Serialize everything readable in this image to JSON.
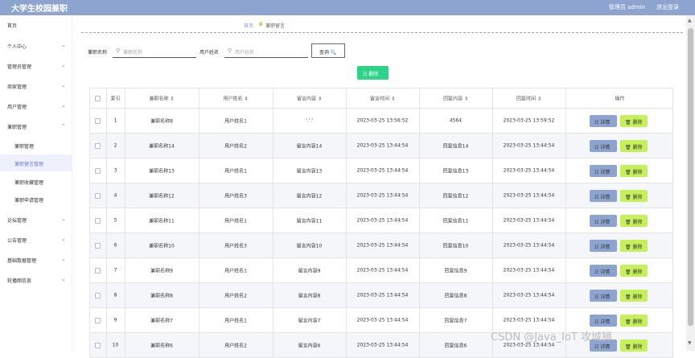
{
  "header": {
    "title": "大学生校园兼职",
    "user": "管理员 admin",
    "logout": "退出登录"
  },
  "sidebar": {
    "items": [
      {
        "label": "首页",
        "chev": ""
      },
      {
        "label": "个人中心",
        "chev": "⌄"
      },
      {
        "label": "管理员管理",
        "chev": "⌄"
      },
      {
        "label": "商家管理",
        "chev": "⌄"
      },
      {
        "label": "用户管理",
        "chev": "⌄"
      },
      {
        "label": "兼职管理",
        "chev": "⌄"
      }
    ],
    "subitems": [
      {
        "label": "兼职管理"
      },
      {
        "label": "兼职留言管理"
      },
      {
        "label": "兼职收藏管理"
      },
      {
        "label": "兼职申请管理"
      }
    ],
    "items2": [
      {
        "label": "论坛管理",
        "chev": "⌄"
      },
      {
        "label": "公告管理",
        "chev": "⌄"
      },
      {
        "label": "基础数据管理",
        "chev": "⌄"
      },
      {
        "label": "轮播图信息",
        "chev": "⌄"
      }
    ]
  },
  "breadcrumb": {
    "home": "首页",
    "sep": "♛",
    "current": "兼职留言"
  },
  "search": {
    "job_label": "兼职名称",
    "job_placeholder": "兼职名称",
    "user_label": "用户姓名",
    "user_placeholder": "用户姓名",
    "query_label": "查询 🔍"
  },
  "actions": {
    "delete_label": "☷ 删除"
  },
  "table": {
    "headers": [
      "索引",
      "兼职名称 ⇕",
      "用户姓名 ⇕",
      "留言内容 ⇕",
      "留言时间 ⇕",
      "回复内容 ⇕",
      "回复时间 ⇕",
      "操作"
    ],
    "detail_label": "☷ 详情",
    "delete_label": "🗑 删除",
    "rows": [
      [
        "1",
        "兼职名称8",
        "用户姓名1",
        "'.'.'",
        "2023-03-25 13:56:52",
        "4564",
        "2023-03-25 13:59:52"
      ],
      [
        "2",
        "兼职名称14",
        "用户姓名2",
        "留言内容14",
        "2023-03-25 13:44:54",
        "回复信息14",
        "2023-03-25 13:44:54"
      ],
      [
        "3",
        "兼职名称13",
        "用户姓名1",
        "留言内容13",
        "2023-03-25 13:44:54",
        "回复信息13",
        "2023-03-25 13:44:54"
      ],
      [
        "4",
        "兼职名称12",
        "用户姓名3",
        "留言内容12",
        "2023-03-25 13:44:54",
        "回复信息12",
        "2023-03-25 13:44:54"
      ],
      [
        "5",
        "兼职名称11",
        "用户姓名1",
        "留言内容11",
        "2023-03-25 13:44:54",
        "回复信息11",
        "2023-03-25 13:44:54"
      ],
      [
        "6",
        "兼职名称10",
        "用户姓名3",
        "留言内容10",
        "2023-03-25 13:44:54",
        "回复信息10",
        "2023-03-25 13:44:54"
      ],
      [
        "7",
        "兼职名称9",
        "用户姓名1",
        "留言内容9",
        "2023-03-25 13:44:54",
        "回复信息9",
        "2023-03-25 13:44:54"
      ],
      [
        "8",
        "兼职名称8",
        "用户姓名2",
        "留言内容8",
        "2023-03-25 13:44:54",
        "回复信息8",
        "2023-03-25 13:44:54"
      ],
      [
        "9",
        "兼职名称7",
        "用户姓名1",
        "留言内容7",
        "2023-03-25 13:44:54",
        "回复信息7",
        "2023-03-25 13:44:54"
      ],
      [
        "10",
        "兼职名称6",
        "用户姓名2",
        "留言内容6",
        "2023-03-25 13:44:54",
        "回复信息6",
        "2023-03-25 13:44:54"
      ]
    ]
  },
  "watermark": "CSDN @Java_IoT 攻城狮",
  "colors": {
    "header": "#8da3d0",
    "delete_green": "#2fd489",
    "row_delete": "#c6f05a"
  }
}
